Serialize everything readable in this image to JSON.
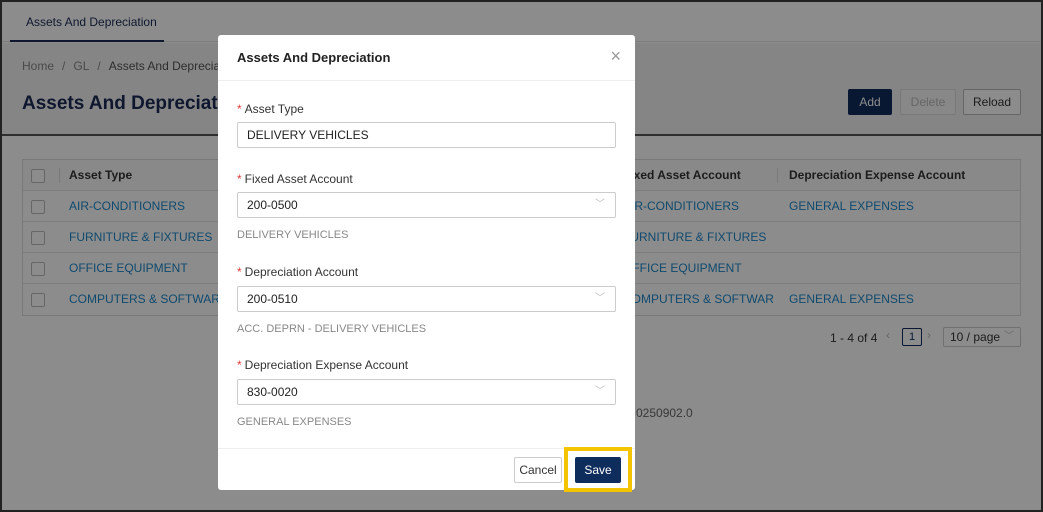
{
  "tabs": [
    {
      "label": "Assets And Depreciation"
    }
  ],
  "breadcrumb": {
    "home": "Home",
    "separator": "/",
    "gl": "GL",
    "current": "Assets And Depreciation"
  },
  "page": {
    "title": "Assets And Depreciation"
  },
  "toolbar": {
    "add_label": "Add",
    "delete_label": "Delete",
    "reload_label": "Reload"
  },
  "table": {
    "headers": [
      "Asset Type",
      "Fixed Asset Account",
      "Depreciation Expense Account"
    ],
    "rows": [
      {
        "asset_type": "AIR-CONDITIONERS",
        "fixed_account": "AIR-CONDITIONERS",
        "expense_account": "GENERAL EXPENSES"
      },
      {
        "asset_type": "FURNITURE & FIXTURES",
        "fixed_account": "FURNITURE & FIXTURES",
        "expense_account": ""
      },
      {
        "asset_type": "OFFICE EQUIPMENT",
        "fixed_account": "OFFICE EQUIPMENT",
        "expense_account": ""
      },
      {
        "asset_type": "COMPUTERS & SOFTWARES",
        "fixed_account": "COMPUTERS & SOFTWARES",
        "expense_account": "GENERAL EXPENSES"
      }
    ]
  },
  "pagination": {
    "range": "1 - 4 of 4",
    "current_page": "1",
    "page_size": "10 / page"
  },
  "footer": {
    "version": "0250902.0"
  },
  "modal": {
    "title": "Assets And Depreciation",
    "close_icon": "×",
    "fields": {
      "asset_type": {
        "label": "Asset Type",
        "value": "DELIVERY VEHICLES"
      },
      "fixed_asset_account": {
        "label": "Fixed Asset Account",
        "value": "200-0500",
        "help": "DELIVERY VEHICLES"
      },
      "depreciation_account": {
        "label": "Depreciation Account",
        "value": "200-0510",
        "help": "ACC. DEPRN - DELIVERY VEHICLES"
      },
      "depreciation_expense_account": {
        "label": "Depreciation Expense Account",
        "value": "830-0020",
        "help": "GENERAL EXPENSES"
      }
    },
    "cancel_label": "Cancel",
    "save_label": "Save"
  },
  "colors": {
    "primary": "#0f2d5c",
    "link": "#1e88c9",
    "required": "#e23b3b",
    "highlight": "#f5c400"
  }
}
